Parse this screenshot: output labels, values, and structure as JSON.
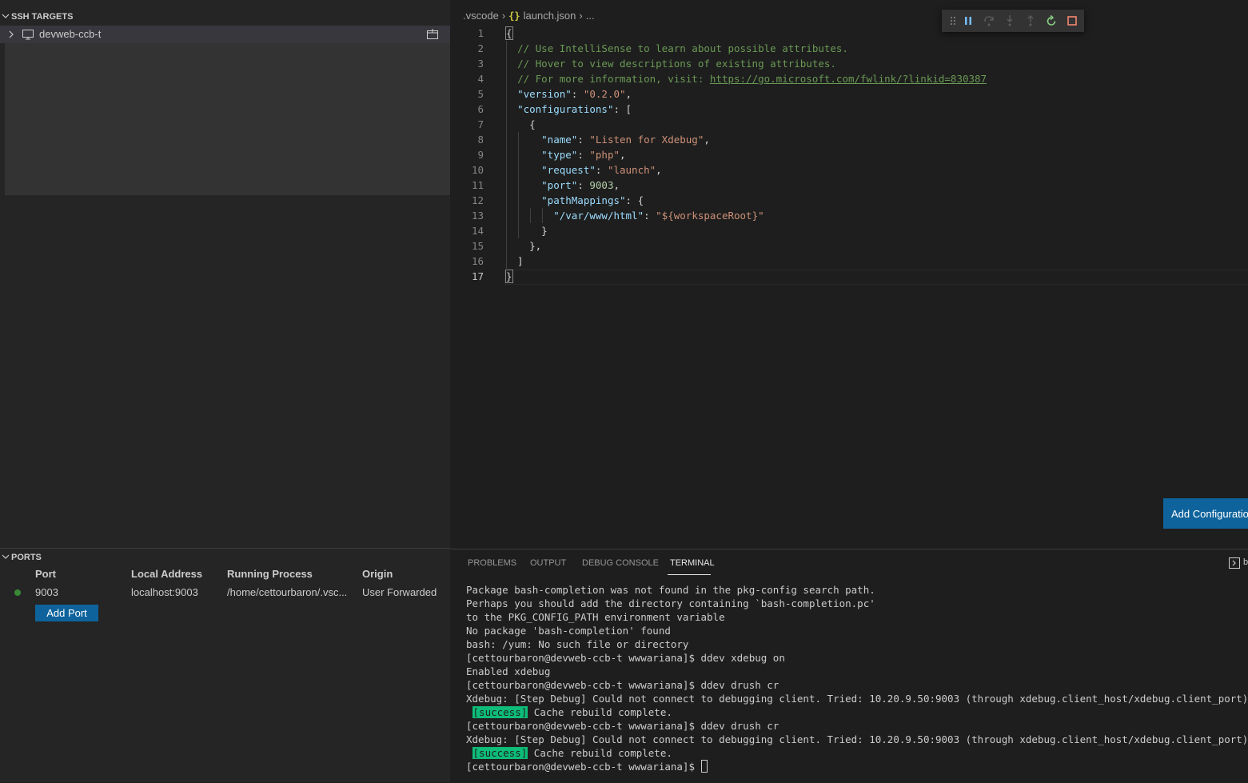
{
  "sidebar": {
    "ssh_targets": {
      "title": "SSH TARGETS",
      "host": "devweb-ccb-t"
    },
    "ports": {
      "title": "PORTS",
      "columns": [
        "Port",
        "Local Address",
        "Running Process",
        "Origin"
      ],
      "rows": [
        {
          "port": "9003",
          "local_address": "localhost:9003",
          "process": "/home/cettourbaron/.vsc...",
          "origin": "User Forwarded"
        }
      ],
      "add_port_label": "Add Port"
    }
  },
  "editor": {
    "breadcrumb": {
      "folder": ".vscode",
      "braces": "{}",
      "file": "launch.json",
      "more": "..."
    },
    "line_numbers": [
      "1",
      "2",
      "3",
      "4",
      "5",
      "6",
      "7",
      "8",
      "9",
      "10",
      "11",
      "12",
      "13",
      "14",
      "15",
      "16",
      "17"
    ],
    "code": {
      "open_brace": "{",
      "comment1": "// Use IntelliSense to learn about possible attributes.",
      "comment2": "// Hover to view descriptions of existing attributes.",
      "comment3": "// For more information, visit: ",
      "link": "https://go.microsoft.com/fwlink/?linkid=830387",
      "version_key": "\"version\"",
      "version_val": "\"0.2.0\"",
      "configs_key": "\"configurations\"",
      "name_key": "\"name\"",
      "name_val": "\"Listen for Xdebug\"",
      "type_key": "\"type\"",
      "type_val": "\"php\"",
      "request_key": "\"request\"",
      "request_val": "\"launch\"",
      "port_key": "\"port\"",
      "port_val": "9003",
      "pathmap_key": "\"pathMappings\"",
      "map_key": "\"/var/www/html\"",
      "map_val": "\"${workspaceRoot}\"",
      "close_brace": "}"
    },
    "add_config_label": "Add Configuration..."
  },
  "panel": {
    "tabs": [
      "PROBLEMS",
      "OUTPUT",
      "DEBUG CONSOLE",
      "TERMINAL"
    ],
    "action_label": "b",
    "terminal": {
      "lines": [
        "Package bash-completion was not found in the pkg-config search path.",
        "Perhaps you should add the directory containing `bash-completion.pc'",
        "to the PKG_CONFIG_PATH environment variable",
        "No package 'bash-completion' found",
        "bash: /yum: No such file or directory",
        "[cettourbaron@devweb-ccb-t wwwariana]$ ddev xdebug on",
        "Enabled xdebug",
        "[cettourbaron@devweb-ccb-t wwwariana]$ ddev drush cr",
        "Xdebug: [Step Debug] Could not connect to debugging client. Tried: 10.20.9.50:9003 (through xdebug.client_host/xdebug.client_port) :-(",
        "[cettourbaron@devweb-ccb-t wwwariana]$ ddev drush cr",
        "Xdebug: [Step Debug] Could not connect to debugging client. Tried: 10.20.9.50:9003 (through xdebug.client_host/xdebug.client_port) :-(",
        "[cettourbaron@devweb-ccb-t wwwariana]$ "
      ],
      "success_badge": "[success]",
      "success_text": " Cache rebuild complete."
    }
  },
  "colors": {
    "accent_button": "#0e639c",
    "success_badge": "#0dbc79",
    "port_dot": "#388a34",
    "debug_continue": "#75beff",
    "debug_restart": "#89d185",
    "debug_stop": "#f48771"
  },
  "icons": [
    "chevron-down-icon",
    "chevron-right-icon",
    "monitor-icon",
    "new-window-icon",
    "drag-gripper-icon",
    "pause-icon",
    "step-over-icon",
    "step-into-icon",
    "step-out-icon",
    "restart-icon",
    "stop-icon",
    "maximize-panel-icon"
  ]
}
